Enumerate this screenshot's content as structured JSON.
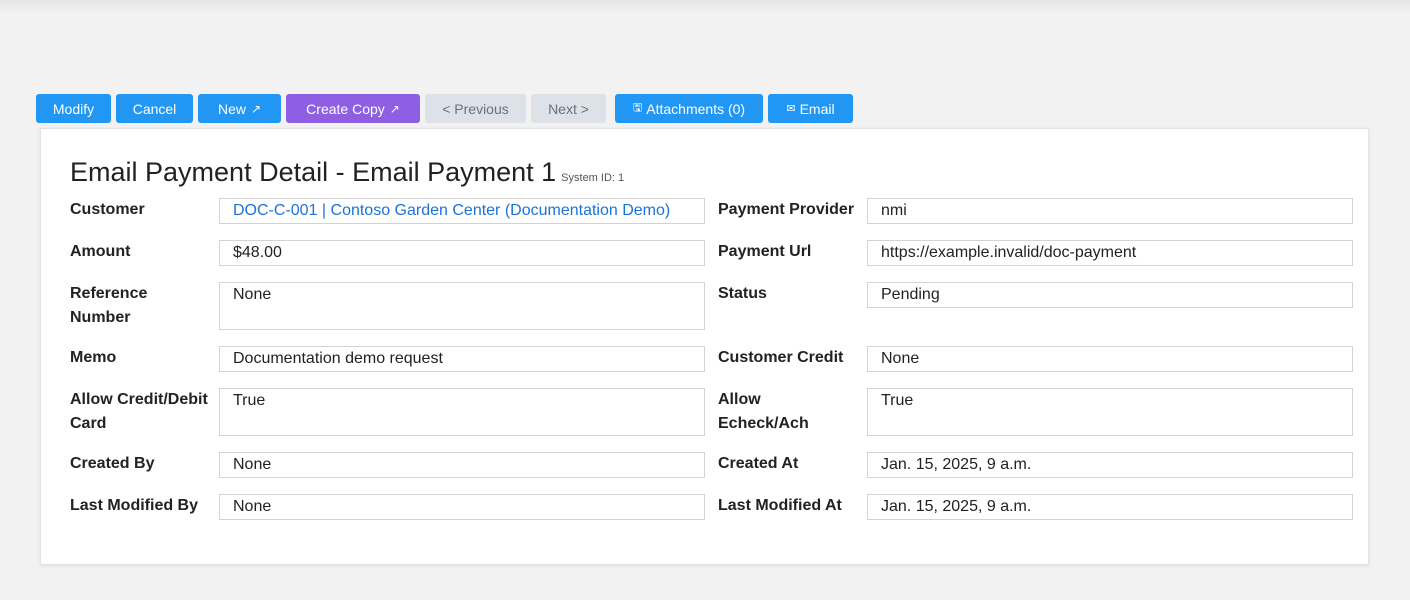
{
  "toolbar": {
    "modify": "Modify",
    "cancel": "Cancel",
    "new": "New",
    "new_icon": "↗",
    "create_copy": "Create Copy",
    "create_copy_icon": "↗",
    "previous": "< Previous",
    "next": "Next >",
    "attachments_icon": "🖫",
    "attachments": "Attachments (0)",
    "email_icon": "✉",
    "email": "Email"
  },
  "page": {
    "title": "Email Payment Detail - Email Payment 1",
    "system_id": "System ID: 1"
  },
  "fields": {
    "customer": {
      "label": "Customer",
      "value": "DOC-C-001 | Contoso Garden Center (Documentation Demo)"
    },
    "amount": {
      "label": "Amount",
      "value": "$48.00"
    },
    "reference_number": {
      "label": "Reference Number",
      "value": "None"
    },
    "memo": {
      "label": "Memo",
      "value": "Documentation demo request"
    },
    "allow_card": {
      "label": "Allow Credit/Debit Card",
      "value": "True"
    },
    "created_by": {
      "label": "Created By",
      "value": "None"
    },
    "last_modified_by": {
      "label": "Last Modified By",
      "value": "None"
    },
    "payment_provider": {
      "label": "Payment Provider",
      "value": "nmi"
    },
    "payment_url": {
      "label": "Payment Url",
      "value": "https://example.invalid/doc-payment"
    },
    "status": {
      "label": "Status",
      "value": "Pending"
    },
    "customer_credit": {
      "label": "Customer Credit",
      "value": "None"
    },
    "allow_echeck": {
      "label": "Allow Echeck/Ach",
      "value": "True"
    },
    "created_at": {
      "label": "Created At",
      "value": "Jan. 15, 2025, 9 a.m."
    },
    "last_modified_at": {
      "label": "Last Modified At",
      "value": "Jan. 15, 2025, 9 a.m."
    }
  },
  "colors": {
    "primary": "#2196f3",
    "purple": "#8e5fe2",
    "disabled": "#dde2e8",
    "link": "#1a73d9"
  }
}
